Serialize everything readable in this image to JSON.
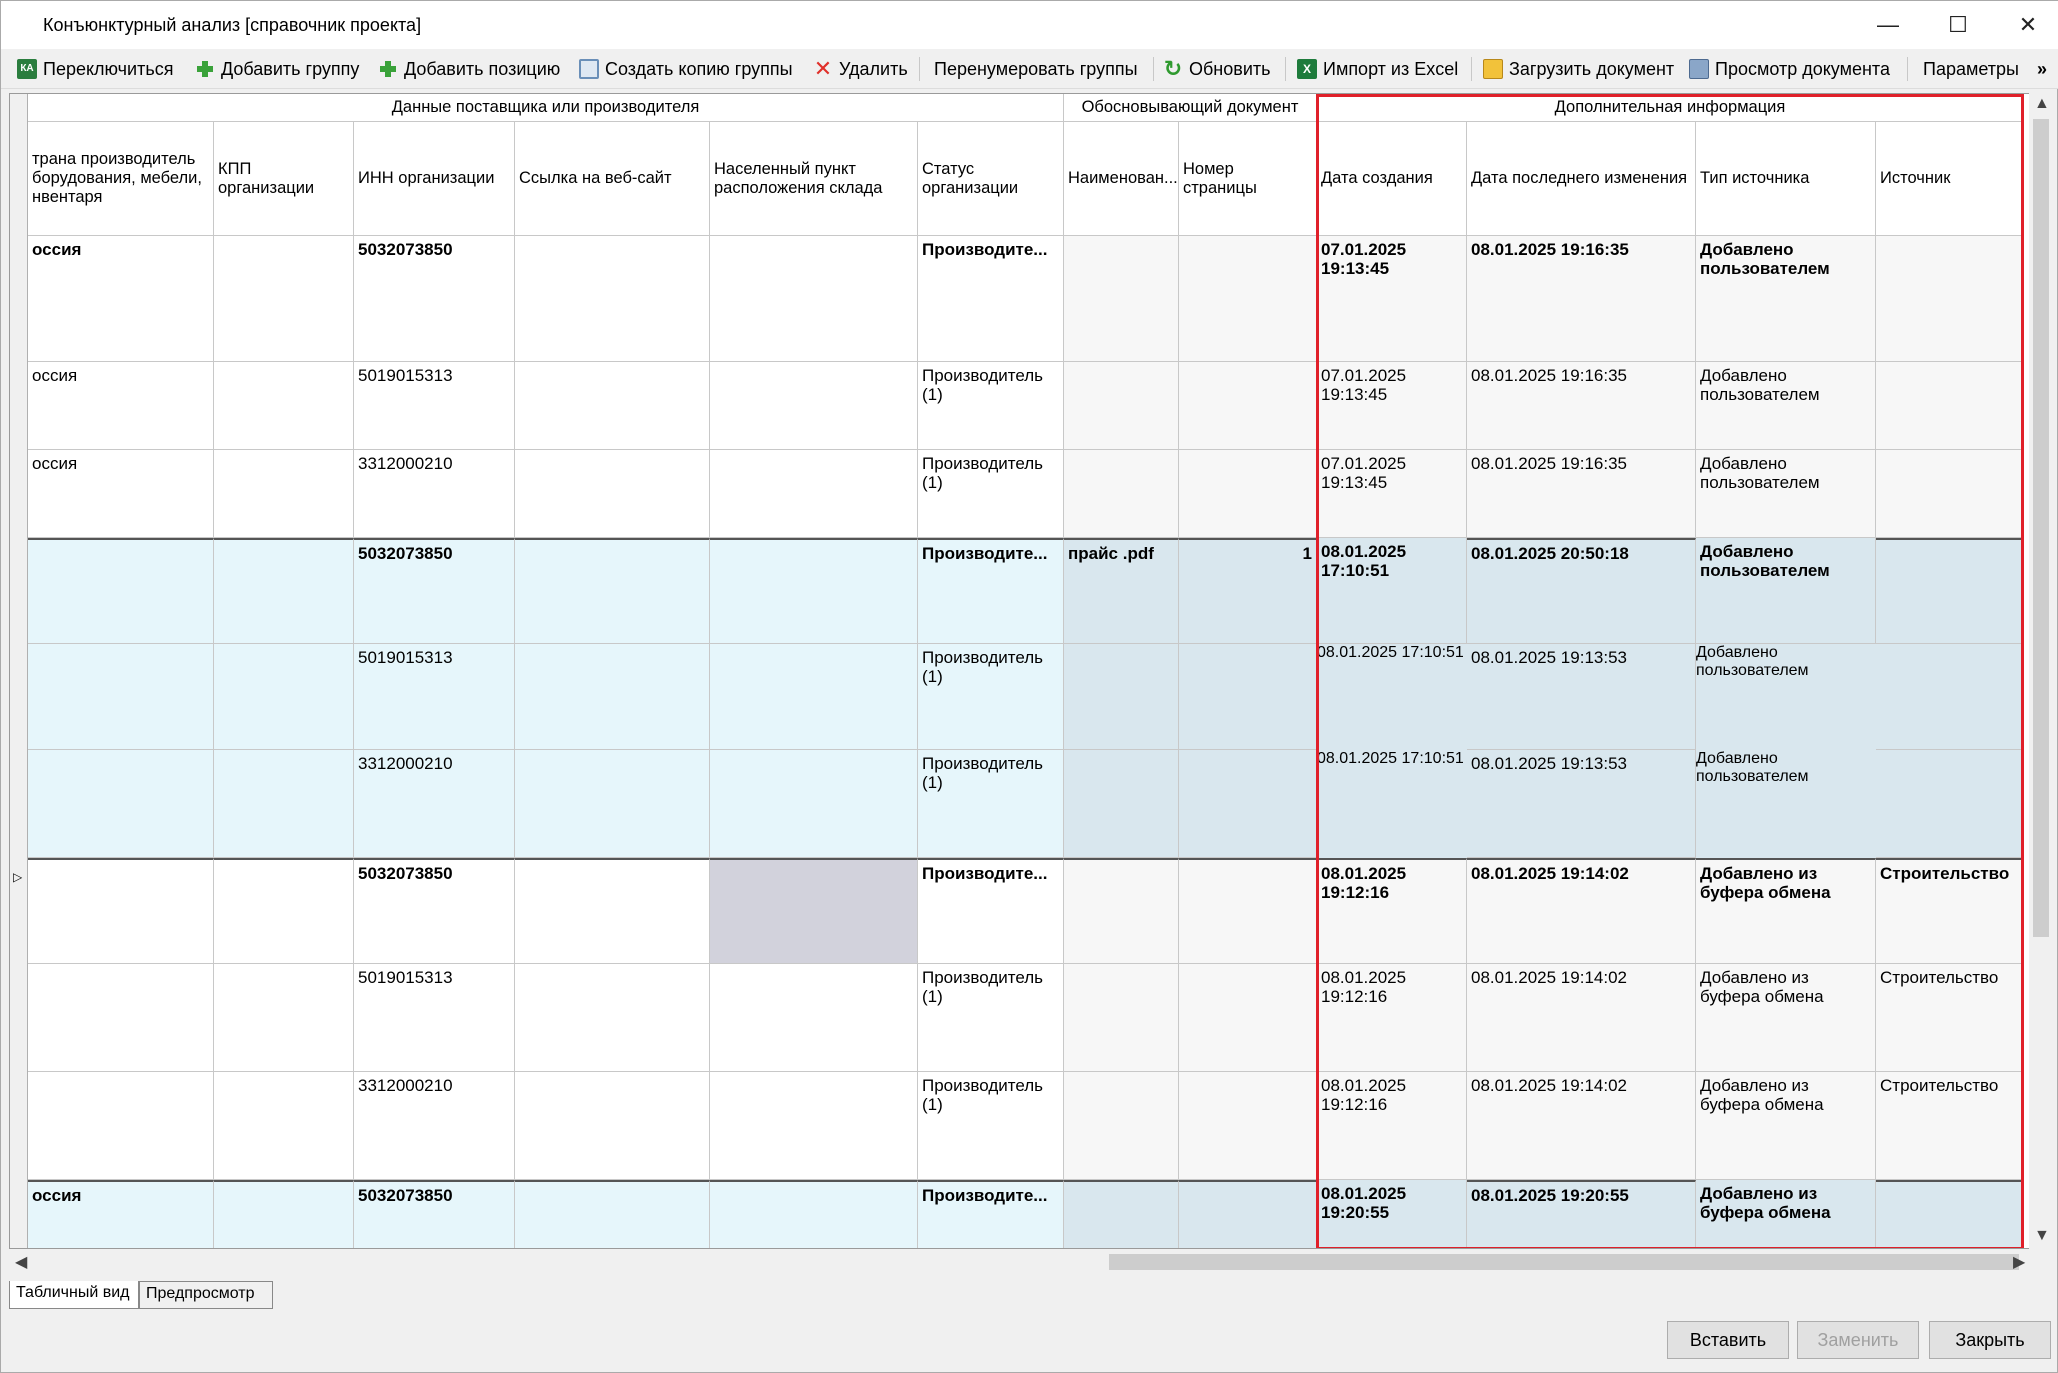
{
  "window": {
    "title": "Конъюнктурный анализ [справочник проекта]",
    "minimize": "—",
    "maximize": "☐",
    "close": "✕"
  },
  "toolbar": {
    "switch": "Переключиться",
    "add_group": "Добавить группу",
    "add_position": "Добавить позицию",
    "copy_group": "Создать копию группы",
    "delete": "Удалить",
    "renumber": "Перенумеровать группы",
    "refresh": "Обновить",
    "import_excel": "Импорт из Excel",
    "upload_doc": "Загрузить документ",
    "view_doc": "Просмотр документа",
    "params": "Параметры",
    "more": "»"
  },
  "grid": {
    "group_headers": {
      "supplier": "Данные поставщика или производителя",
      "justifying": "Обосновывающий документ",
      "extra": "Дополнительная информация"
    },
    "columns": {
      "country": "трана производитель борудования, мебели, нвентаря",
      "kpp": "КПП организации",
      "inn": "ИНН организации",
      "website": "Ссылка на веб-сайт",
      "locality": "Населенный пункт расположения склада",
      "status": "Статус организации",
      "doc_name": "Наименован...",
      "page_no": "Номер страницы",
      "created": "Дата создания",
      "modified": "Дата последнего изменения",
      "source_type": "Тип источника",
      "source": "Источник"
    },
    "rows": [
      {
        "country": "оссия",
        "inn": "5032073850",
        "status": "Производите...",
        "doc": "",
        "page": "",
        "created": "07.01.2025 19:13:45",
        "modified": "08.01.2025 19:16:35",
        "stype": "Добавлено пользователем",
        "source": ""
      },
      {
        "country": "оссия",
        "inn": "5019015313",
        "status": "Производитель (1)",
        "doc": "",
        "page": "",
        "created": "07.01.2025 19:13:45",
        "modified": "08.01.2025 19:16:35",
        "stype": "Добавлено пользователем",
        "source": ""
      },
      {
        "country": "оссия",
        "inn": "3312000210",
        "status": "Производитель (1)",
        "doc": "",
        "page": "",
        "created": "07.01.2025 19:13:45",
        "modified": "08.01.2025 19:16:35",
        "stype": "Добавлено пользователем",
        "source": ""
      },
      {
        "country": "",
        "inn": "5032073850",
        "status": "Производите...",
        "doc": "прайс .pdf",
        "page": "1",
        "created": "08.01.2025 17:10:51",
        "modified": "08.01.2025 20:50:18",
        "stype": "Добавлено пользователем",
        "source": ""
      },
      {
        "country": "",
        "inn": "5019015313",
        "status": "Производитель (1)",
        "doc": "",
        "page": "",
        "created": "08.01.2025 17:10:51",
        "modified": "08.01.2025 19:13:53",
        "stype": "Добавлено пользователем",
        "source": ""
      },
      {
        "country": "",
        "inn": "3312000210",
        "status": "Производитель (1)",
        "doc": "",
        "page": "",
        "created": "08.01.2025 17:10:51",
        "modified": "08.01.2025 19:13:53",
        "stype": "Добавлено пользователем",
        "source": ""
      },
      {
        "country": "",
        "inn": "5032073850",
        "status": "Производите...",
        "doc": "",
        "page": "",
        "created": "08.01.2025 19:12:16",
        "modified": "08.01.2025 19:14:02",
        "stype": "Добавлено из буфера обмена",
        "source": "Строительство"
      },
      {
        "country": "",
        "inn": "5019015313",
        "status": "Производитель (1)",
        "doc": "",
        "page": "",
        "created": "08.01.2025 19:12:16",
        "modified": "08.01.2025 19:14:02",
        "stype": "Добавлено из буфера обмена",
        "source": "Строительство"
      },
      {
        "country": "",
        "inn": "3312000210",
        "status": "Производитель (1)",
        "doc": "",
        "page": "",
        "created": "08.01.2025 19:12:16",
        "modified": "08.01.2025 19:14:02",
        "stype": "Добавлено из буфера обмена",
        "source": "Строительство"
      },
      {
        "country": "оссия",
        "inn": "5032073850",
        "status": "Производите...",
        "doc": "",
        "page": "",
        "created": "08.01.2025 19:20:55",
        "modified": "08.01.2025 19:20:55",
        "stype": "Добавлено из буфера обмена",
        "source": ""
      }
    ]
  },
  "tabs": {
    "table_view": "Табличный вид",
    "preview": "Предпросмотр"
  },
  "buttons": {
    "insert": "Вставить",
    "replace": "Заменить",
    "close": "Закрыть"
  },
  "colors": {
    "highlight": "#e0202a",
    "blue_row": "#e6f6fb"
  }
}
